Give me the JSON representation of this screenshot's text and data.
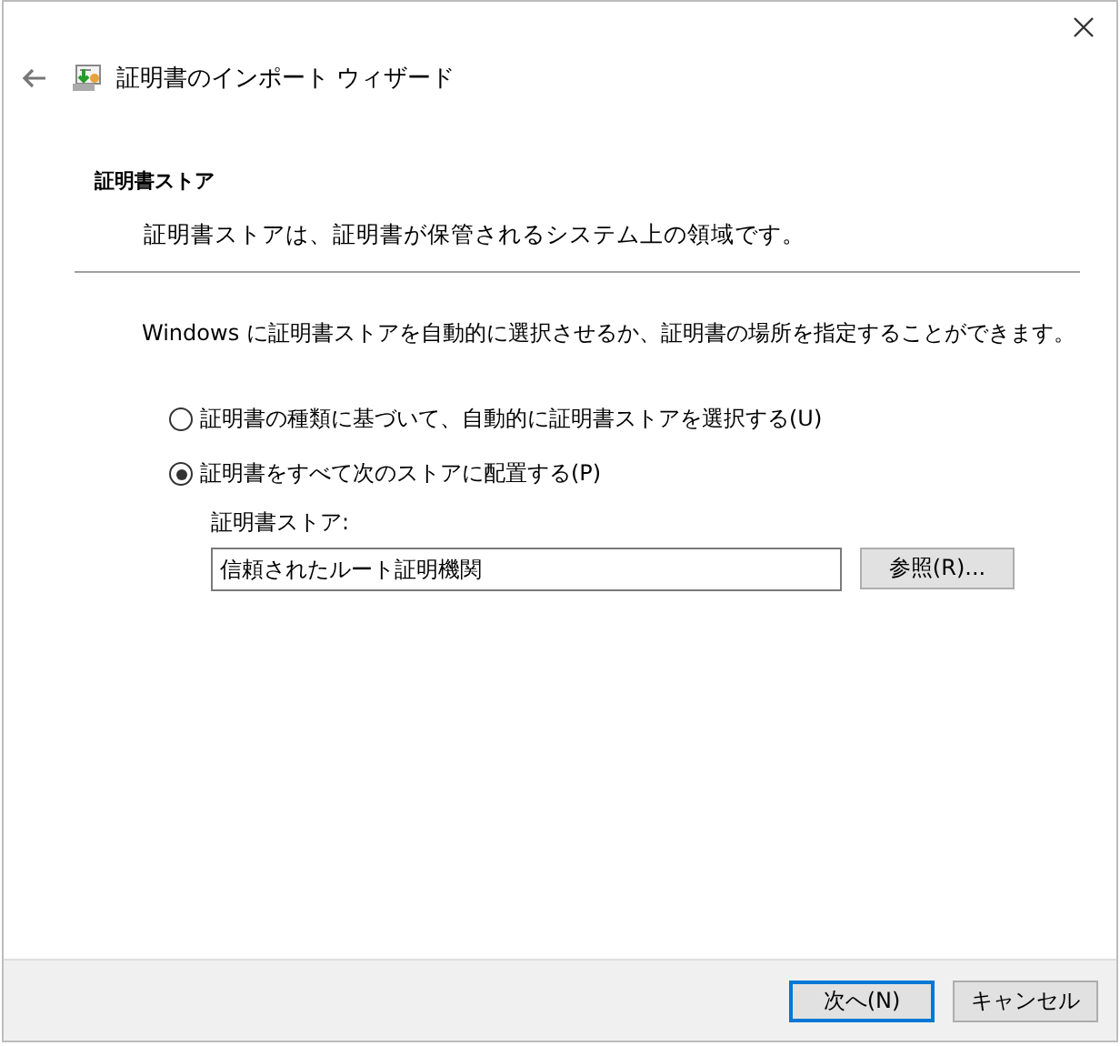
{
  "window": {
    "title": "証明書のインポート ウィザード"
  },
  "section": {
    "heading": "証明書ストア",
    "description": "証明書ストアは、証明書が保管されるシステム上の領域です。"
  },
  "instruction": "Windows に証明書ストアを自動的に選択させるか、証明書の場所を指定することができます。",
  "options": [
    {
      "label": "証明書の種類に基づいて、自動的に証明書ストアを選択する(U)",
      "selected": false
    },
    {
      "label": "証明書をすべて次のストアに配置する(P)",
      "selected": true
    }
  ],
  "store_field": {
    "label": "証明書ストア:",
    "value": "信頼されたルート証明機関"
  },
  "browse_button": "参照(R)...",
  "buttons": [
    {
      "label": "次へ(N)",
      "default": true
    },
    {
      "label": "キャンセル",
      "default": false
    }
  ]
}
